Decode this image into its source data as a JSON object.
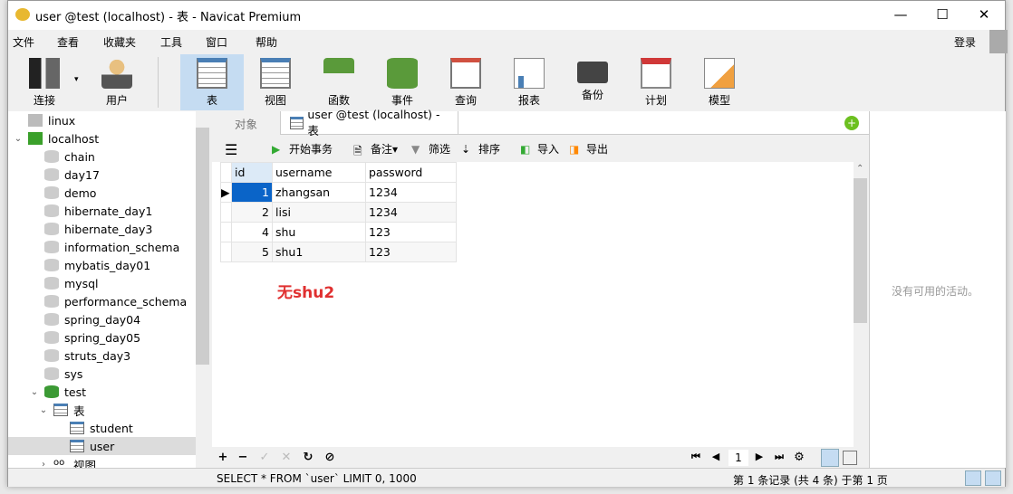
{
  "window": {
    "title": "user @test (localhost) - 表 - Navicat Premium",
    "minimize": "—",
    "maximize": "☐",
    "close": "✕"
  },
  "menu": [
    "文件",
    "查看",
    "收藏夹",
    "工具",
    "窗口",
    "帮助"
  ],
  "login": "登录",
  "toolbar": [
    {
      "label": "连接",
      "icon": "connection-icon"
    },
    {
      "label": "用户",
      "icon": "user-icon"
    },
    {
      "label": "表",
      "icon": "table-icon",
      "selected": true
    },
    {
      "label": "视图",
      "icon": "view-icon"
    },
    {
      "label": "函数",
      "icon": "function-icon"
    },
    {
      "label": "事件",
      "icon": "event-icon"
    },
    {
      "label": "查询",
      "icon": "query-icon"
    },
    {
      "label": "报表",
      "icon": "report-icon"
    },
    {
      "label": "备份",
      "icon": "backup-icon"
    },
    {
      "label": "计划",
      "icon": "schedule-icon"
    },
    {
      "label": "模型",
      "icon": "model-icon"
    }
  ],
  "tree": [
    {
      "label": "linux",
      "type": "server",
      "level": 0
    },
    {
      "label": "localhost",
      "type": "server-open",
      "level": 0,
      "expanded": true
    },
    {
      "label": "chain",
      "type": "db",
      "level": 1
    },
    {
      "label": "day17",
      "type": "db",
      "level": 1
    },
    {
      "label": "demo",
      "type": "db",
      "level": 1
    },
    {
      "label": "hibernate_day1",
      "type": "db",
      "level": 1
    },
    {
      "label": "hibernate_day3",
      "type": "db",
      "level": 1
    },
    {
      "label": "information_schema",
      "type": "db",
      "level": 1
    },
    {
      "label": "mybatis_day01",
      "type": "db",
      "level": 1
    },
    {
      "label": "mysql",
      "type": "db",
      "level": 1
    },
    {
      "label": "performance_schema",
      "type": "db",
      "level": 1
    },
    {
      "label": "spring_day04",
      "type": "db",
      "level": 1
    },
    {
      "label": "spring_day05",
      "type": "db",
      "level": 1
    },
    {
      "label": "struts_day3",
      "type": "db",
      "level": 1
    },
    {
      "label": "sys",
      "type": "db",
      "level": 1
    },
    {
      "label": "test",
      "type": "db-open",
      "level": 1,
      "expanded": true
    },
    {
      "label": "表",
      "type": "tables",
      "level": 2,
      "expanded": true
    },
    {
      "label": "student",
      "type": "table",
      "level": 3
    },
    {
      "label": "user",
      "type": "table",
      "level": 3,
      "selected": true
    },
    {
      "label": "视图",
      "type": "views",
      "level": 2
    }
  ],
  "tabs": {
    "objects": "对象",
    "active": "user @test (localhost) - 表"
  },
  "data_toolbar": {
    "begin_transaction": "开始事务",
    "memo": "备注",
    "filter": "筛选",
    "sort": "排序",
    "import": "导入",
    "export": "导出"
  },
  "grid": {
    "columns": [
      "id",
      "username",
      "password"
    ],
    "rows": [
      [
        "1",
        "zhangsan",
        "1234"
      ],
      [
        "2",
        "lisi",
        "1234"
      ],
      [
        "4",
        "shu",
        "123"
      ],
      [
        "5",
        "shu1",
        "123"
      ]
    ]
  },
  "annotation": "无shu2",
  "annotation_color": "#e03030",
  "bottom": {
    "page": "1"
  },
  "right_panel": {
    "empty": "没有可用的活动。"
  },
  "status": {
    "sql": "SELECT * FROM `user` LIMIT 0, 1000",
    "records": "第 1 条记录 (共 4 条) 于第 1 页"
  }
}
